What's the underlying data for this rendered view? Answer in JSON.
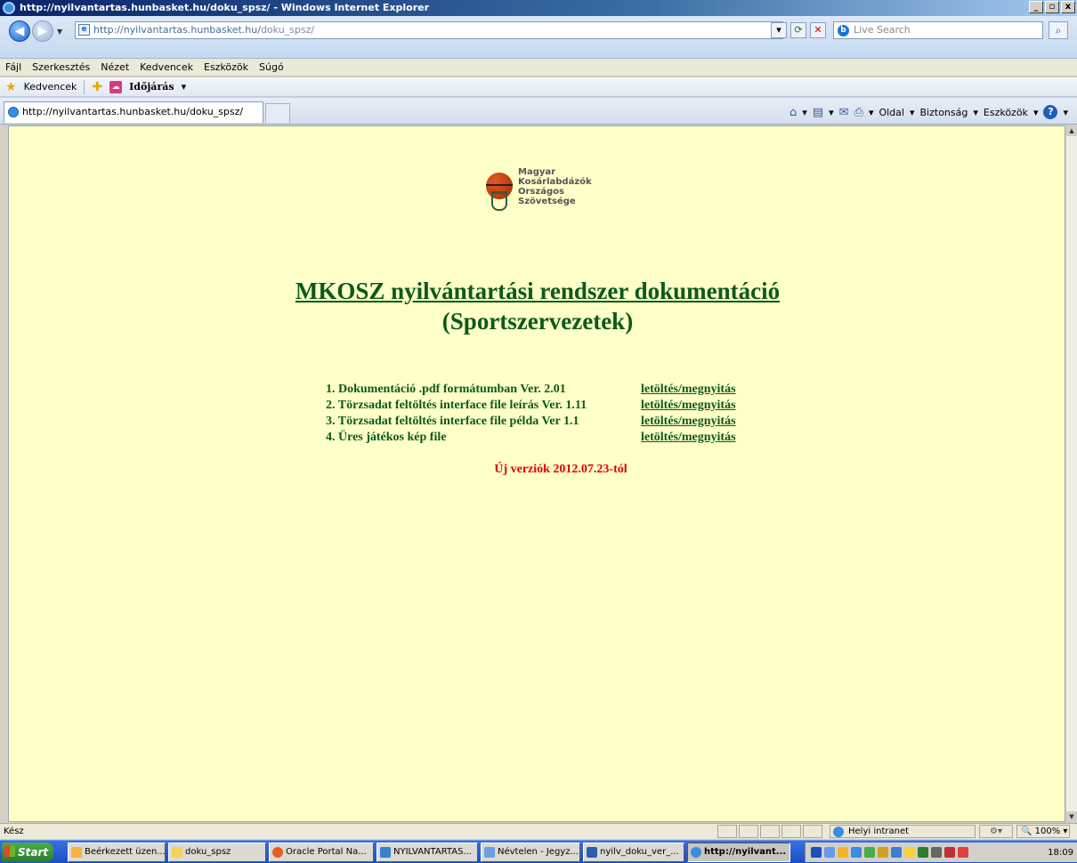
{
  "window": {
    "title": "http://nyilvantartas.hunbasket.hu/doku_spsz/ - Windows Internet Explorer",
    "controls": [
      "_",
      "▫",
      "x"
    ]
  },
  "addressbar": {
    "url_host": "http://nyilvantartas.hunbasket.hu/",
    "url_path": "doku_spsz/",
    "search_placeholder": "Live Search"
  },
  "menu": [
    "Fájl",
    "Szerkesztés",
    "Nézet",
    "Kedvencek",
    "Eszközök",
    "Súgó"
  ],
  "favorites": {
    "label": "Kedvencek",
    "weather": "Időjárás"
  },
  "tab": {
    "title": "http://nyilvantartas.hunbasket.hu/doku_spsz/"
  },
  "commandbar": {
    "page": "Oldal",
    "safety": "Biztonság",
    "tools": "Eszközök"
  },
  "logo": {
    "lines": [
      "Magyar",
      "Kosárlabdázók",
      "Országos",
      "Szövetsége"
    ]
  },
  "page": {
    "title": "MKOSZ nyilvántartási rendszer dokumentáció",
    "subtitle": "(Sportszervezetek)",
    "documents": [
      {
        "label": "1. Dokumentáció .pdf formátumban Ver. 2.01",
        "link": "letöltés/megnyitás"
      },
      {
        "label": "2. Törzsadat feltöltés interface file leírás Ver. 1.11",
        "link": "letöltés/megnyitás"
      },
      {
        "label": "3. Törzsadat feltöltés interface file példa Ver 1.1",
        "link": "letöltés/megnyitás"
      },
      {
        "label": "4. Üres játékos kép file",
        "link": "letöltés/megnyitás"
      }
    ],
    "new_versions": "Új verziók 2012.07.23-tól"
  },
  "statusbar": {
    "text": "Kész",
    "zone": "Helyi intranet",
    "zoom": "100%"
  },
  "taskbar": {
    "start": "Start",
    "tasks": [
      {
        "label": "Beérkezett üzen...",
        "color": "#f5b440"
      },
      {
        "label": "doku_spsz",
        "color": "#f2d25a"
      },
      {
        "label": "Oracle Portal Na...",
        "color": "#e06020"
      },
      {
        "label": "NYILVANTARTAS...",
        "color": "#3a7fd0"
      },
      {
        "label": "Névtelen - Jegyz...",
        "color": "#6aa0e0"
      },
      {
        "label": "nyilv_doku_ver_...",
        "color": "#2b5fb0"
      },
      {
        "label": "http://nyilvant...",
        "color": "#3b8de0",
        "active": true
      }
    ],
    "clock": "18:09"
  },
  "colors": {
    "page_bg": "#ffffc8",
    "title_green": "#0b5a1c",
    "notice_red": "#e00000"
  }
}
